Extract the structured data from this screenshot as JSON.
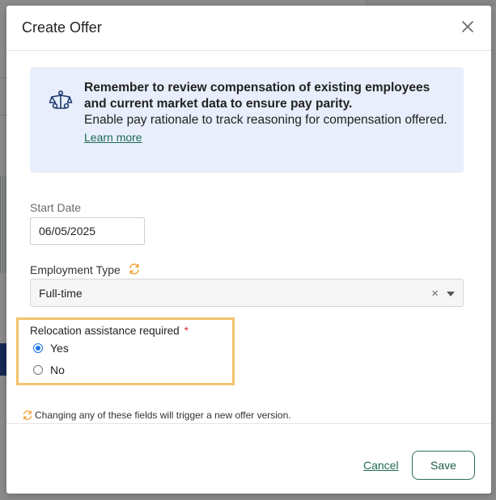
{
  "dialog": {
    "title": "Create Offer"
  },
  "info": {
    "heading": "Remember to review compensation of existing employees and current market data to ensure pay parity.",
    "body": "Enable pay rationale to track reasoning for compensation offered.",
    "link": "Learn more",
    "icon": "scale-people-icon"
  },
  "form": {
    "start_date": {
      "label": "Start Date",
      "value": "06/05/2025"
    },
    "employment_type": {
      "label": "Employment Type",
      "value": "Full-time",
      "clear": "×"
    },
    "relocation": {
      "label": "Relocation assistance required",
      "required_mark": "*",
      "options": [
        {
          "label": "Yes",
          "selected": true
        },
        {
          "label": "No",
          "selected": false
        }
      ]
    },
    "version_note": "Changing any of these fields will trigger a new offer version."
  },
  "footer": {
    "cancel_label": "Cancel",
    "save_label": "Save"
  },
  "colors": {
    "accent": "#1f6b55",
    "highlight": "#f5c36b",
    "sync": "#f0a030",
    "info_bg": "#e8eefb"
  }
}
